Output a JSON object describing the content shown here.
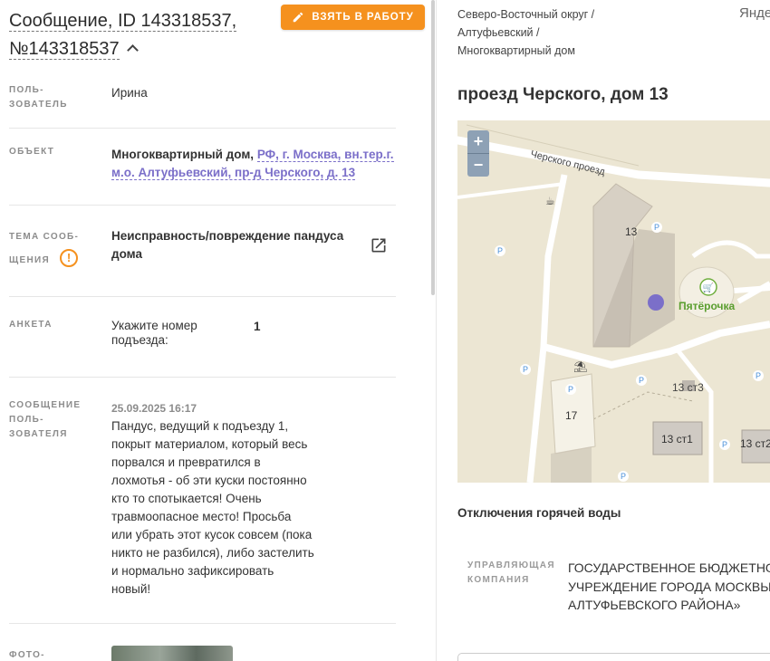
{
  "header": {
    "title": "Сообщение, ID 143318537, №143318537",
    "take_button": "ВЗЯТЬ В РАБОТУ"
  },
  "fields": {
    "user": {
      "label_1": "ПОЛЬ-",
      "label_2": "ЗОВАТЕЛЬ",
      "value": "Ирина"
    },
    "object": {
      "label": "ОБЪЕКТ",
      "type": "Многоквартирный дом,",
      "address_1": "РФ, г. Москва, вн.тер.г.",
      "address_2": "м.о. Алтуфьевский, пр-д Черского, д. 13"
    },
    "topic": {
      "label_1": "ТЕМА СООБ-",
      "label_2": "ЩЕНИЯ",
      "warn_glyph": "!",
      "value_1": "Неисправность/повреждение пандуса",
      "value_2": "дома"
    },
    "survey": {
      "label": "АНКЕТА",
      "question_1": "Укажите номер",
      "question_2": "подъезда:",
      "answer": "1"
    },
    "message": {
      "label_1": "СООБЩЕНИЕ",
      "label_2": "ПОЛЬ-",
      "label_3": "ЗОВАТЕЛЯ",
      "date": "25.09.2025 16:17",
      "lines": [
        "Пандус, ведущий к подъезду 1,",
        "покрыт материалом, который весь",
        "порвался и превратился в",
        "лохмотья - об эти куски постоянно",
        "кто то спотыкается! Очень",
        "травмоопасное место! Просьба",
        "или убрать этот кусок совсем (пока",
        "никто не разбился), либо застелить",
        "и нормально зафиксировать",
        "новый!"
      ]
    },
    "photo": {
      "label": "ФОТО-"
    }
  },
  "right": {
    "breadcrumbs": [
      "Северо-Восточный округ /",
      "Алтуфьевский /",
      "Многоквартирный дом"
    ],
    "yandex": "Янде",
    "address_title": "проезд Черского, дом 13",
    "map": {
      "zoom_in": "+",
      "zoom_out": "−",
      "street": "Черского проезд",
      "b13": "13",
      "b17": "17",
      "b13s3": "13 ст3",
      "b13s1": "13 ст1",
      "b13s2": "13 ст2",
      "shop": "Пятёрочка",
      "parking": "P"
    },
    "hot_water_title": "Отключения горячей воды",
    "company": {
      "label_1": "УПРАВЛЯЮЩАЯ",
      "label_2": "КОМПАНИЯ",
      "value_1": "ГОСУДАРСТВЕННОЕ БЮДЖЕТНОЕ",
      "value_2": "УЧРЕЖДЕНИЕ ГОРОДА МОСКВЫ «Ж",
      "value_3": "АЛТУФЬЕВСКОГО РАЙОНА»"
    }
  }
}
